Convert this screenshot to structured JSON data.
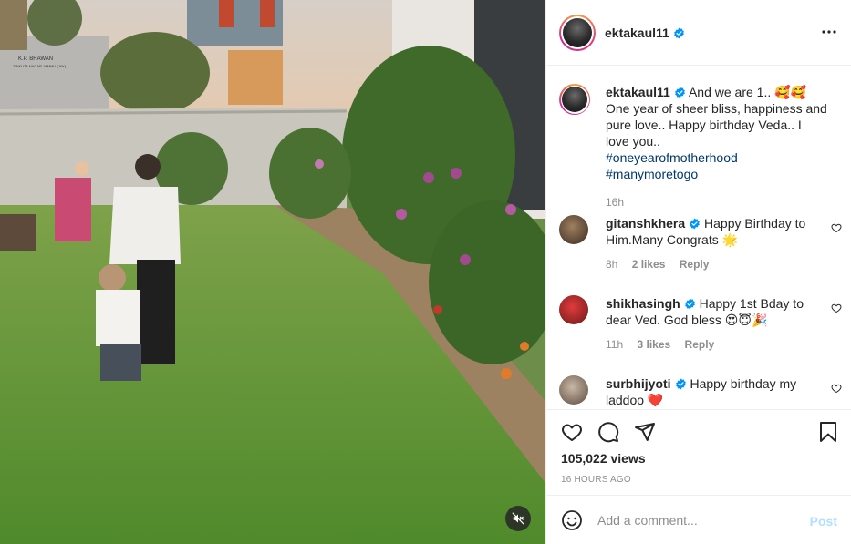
{
  "post": {
    "username": "ektakaul11",
    "caption_text": "And we are 1.. 🥰🥰One year of sheer bliss, happiness and pure love.. Happy birthday Veda.. I love you..",
    "hashtags": [
      "#oneyearofmotherhood",
      "#manymoretogo"
    ],
    "caption_time": "16h",
    "views": "105,022 views",
    "posted_ago": "16 HOURS AGO"
  },
  "comments": [
    {
      "username": "gitanshkhera",
      "text": "Happy Birthday to Him.Many Congrats 🌟",
      "time": "8h",
      "likes": "2 likes",
      "reply": "Reply"
    },
    {
      "username": "shikhasingh",
      "text": "Happy 1st Bday to dear Ved. God bless 😍😇🎉",
      "time": "11h",
      "likes": "3 likes",
      "reply": "Reply"
    },
    {
      "username": "surbhijyoti",
      "text": "Happy birthday my laddoo ❤️",
      "time": "",
      "likes": "",
      "reply": ""
    }
  ],
  "add_comment": {
    "placeholder": "Add a comment...",
    "post_label": "Post"
  },
  "icons": {
    "more": "more-options-icon",
    "like": "heart-icon",
    "comment": "comment-icon",
    "share": "paper-plane-icon",
    "save": "bookmark-icon",
    "emoji": "emoji-icon",
    "mute": "audio-muted-icon",
    "verified": "verified-badge-icon"
  },
  "colors": {
    "link": "#00376b",
    "verified": "#0095f6",
    "post_disabled": "#b2dffc",
    "meta": "#8e8e8e"
  },
  "media_sign": {
    "line1": "K.P. BHAWAN",
    "line2": "TRIKUTA NAGAR JAMMU (J&K)"
  }
}
